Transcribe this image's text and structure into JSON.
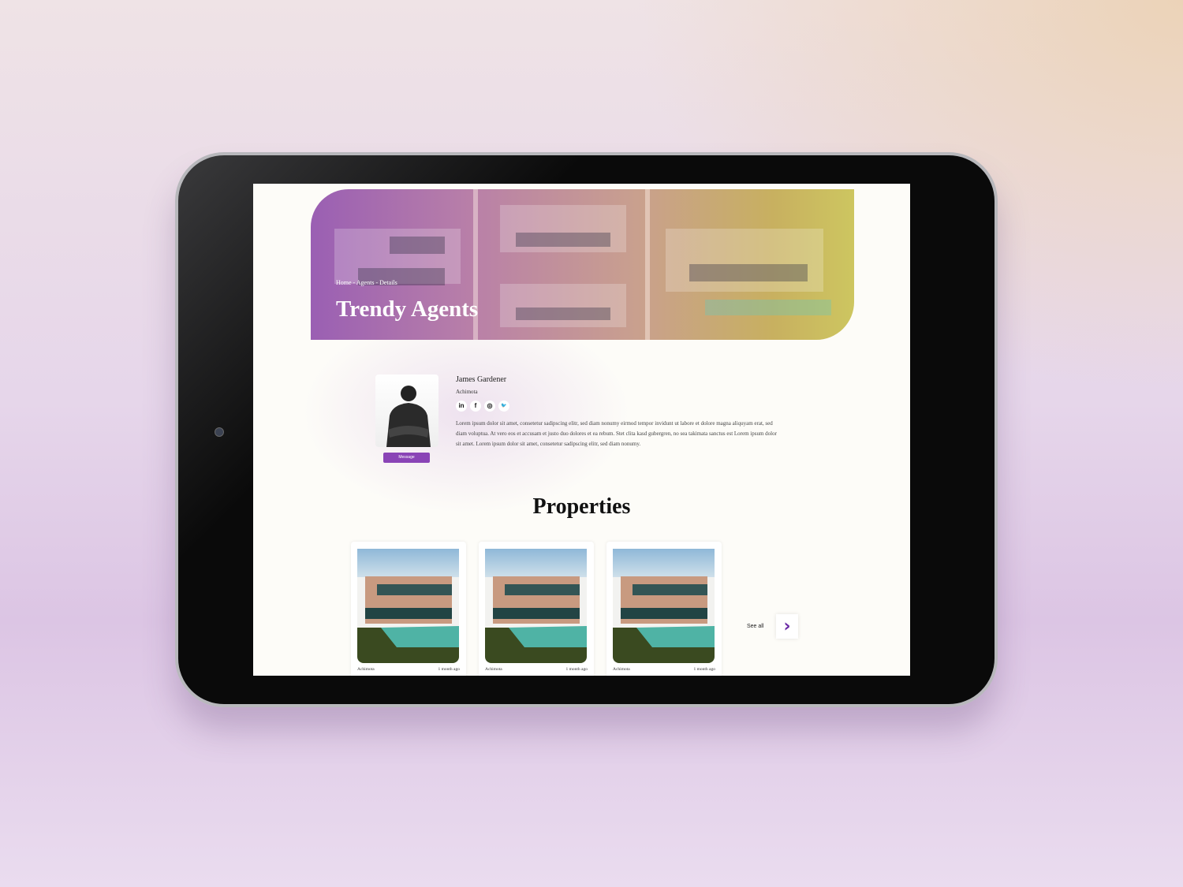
{
  "banner": {
    "breadcrumb": "Home - Agents - Details",
    "title": "Trendy Agents"
  },
  "agent": {
    "name": "James Gardener",
    "location": "Achimota",
    "message_label": "Message",
    "socials": [
      {
        "icon": "linkedin-icon",
        "glyph": "in"
      },
      {
        "icon": "facebook-icon",
        "glyph": "f"
      },
      {
        "icon": "instagram-icon",
        "glyph": "◎"
      },
      {
        "icon": "twitter-icon",
        "glyph": "🐦"
      }
    ],
    "bio": "Lorem ipsum dolor sit amet, consetetur sadipscing elitr, sed diam nonumy eirmod tempor invidunt ut labore et dolore magna aliquyam erat, sed diam voluptua. At vero eos et accusam et justo duo dolores et ea rebum. Stet clita kasd gubergren, no sea takimata sanctus est Lorem ipsum dolor sit amet. Lorem ipsum dolor sit amet, consetetur sadipscing elitr, sed diam nonumy."
  },
  "properties": {
    "heading": "Properties",
    "see_all": "See all",
    "next_glyph": "›",
    "cards": [
      {
        "location": "Achimota",
        "time": "1 month ago"
      },
      {
        "location": "Achimota",
        "time": "1 month ago"
      },
      {
        "location": "Achimota",
        "time": "1 month ago"
      }
    ]
  },
  "colors": {
    "accent": "#8a44b6"
  }
}
